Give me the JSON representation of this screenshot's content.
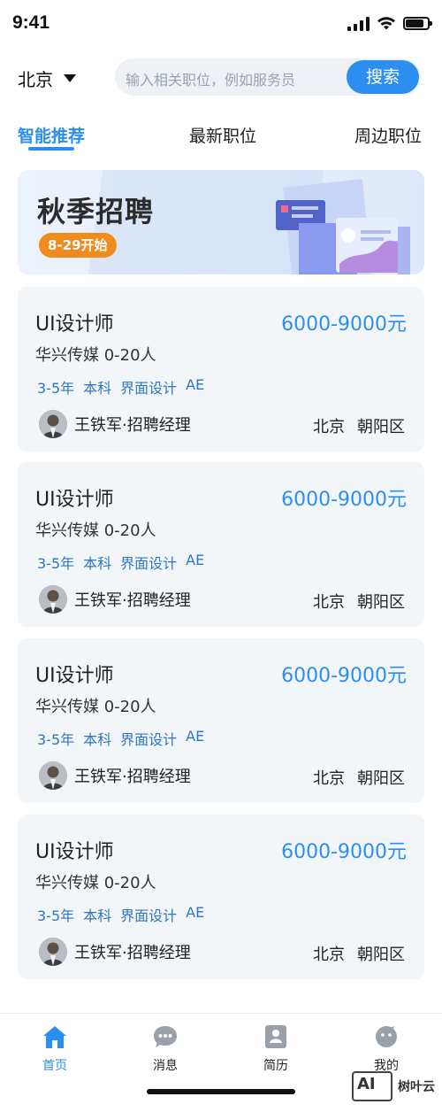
{
  "status_bar": {
    "time": "9:41",
    "battery_level": 0.85,
    "signal_bars": 4
  },
  "header": {
    "city": "北京",
    "search_placeholder": "输入相关职位，例如服务员",
    "search_button": "搜索"
  },
  "tabs": [
    {
      "label": "智能推荐",
      "active": true
    },
    {
      "label": "最新职位",
      "active": false
    },
    {
      "label": "周边职位",
      "active": false
    }
  ],
  "banner": {
    "title": "秋季招聘",
    "badge": "8-29开始"
  },
  "jobs": [
    {
      "title": "UI设计师",
      "salary": "6000-9000元",
      "company": "华兴传媒 0-20人",
      "tags": [
        "3-5年",
        "本科",
        "界面设计",
        "AE"
      ],
      "recruiter": "王铁军·招聘经理",
      "city": "北京",
      "district": "朝阳区"
    },
    {
      "title": "UI设计师",
      "salary": "6000-9000元",
      "company": "华兴传媒 0-20人",
      "tags": [
        "3-5年",
        "本科",
        "界面设计",
        "AE"
      ],
      "recruiter": "王铁军·招聘经理",
      "city": "北京",
      "district": "朝阳区"
    },
    {
      "title": "UI设计师",
      "salary": "6000-9000元",
      "company": "华兴传媒 0-20人",
      "tags": [
        "3-5年",
        "本科",
        "界面设计",
        "AE"
      ],
      "recruiter": "王铁军·招聘经理",
      "city": "北京",
      "district": "朝阳区"
    },
    {
      "title": "UI设计师",
      "salary": "6000-9000元",
      "company": "华兴传媒 0-20人",
      "tags": [
        "3-5年",
        "本科",
        "界面设计",
        "AE"
      ],
      "recruiter": "王铁军·招聘经理",
      "city": "北京",
      "district": "朝阳区"
    }
  ],
  "tabbar": [
    {
      "label": "首页",
      "icon": "home-icon",
      "active": true
    },
    {
      "label": "消息",
      "icon": "message-icon",
      "active": false
    },
    {
      "label": "简历",
      "icon": "resume-icon",
      "active": false
    },
    {
      "label": "我的",
      "icon": "profile-icon",
      "active": false
    }
  ],
  "watermark": {
    "logo": "AI",
    "text": "树叶云"
  },
  "colors": {
    "accent": "#2c8ff0",
    "badge": "#f08b1d",
    "card_bg": "#f3f6f9",
    "tag": "#2e76c2"
  }
}
